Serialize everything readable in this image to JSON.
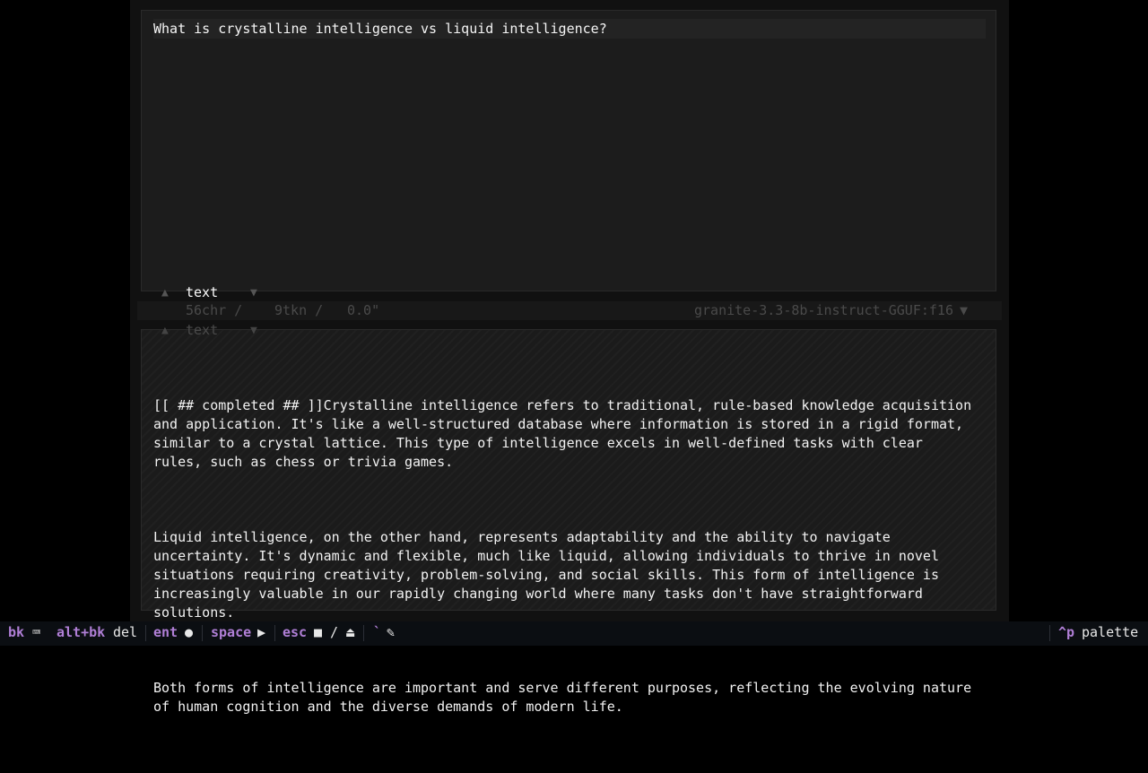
{
  "prompt": {
    "text": "What is crystalline intelligence vs liquid intelligence?"
  },
  "input_type": {
    "label": "text",
    "up": "▲",
    "down": "▼"
  },
  "meta": {
    "chars": "56chr /",
    "tokens": "9tkn /",
    "time": "0.0\"",
    "model": "granite-3.3-8b-instruct-GGUF:f16",
    "model_arrow": "▼"
  },
  "output_type": {
    "label": "text",
    "up": "▲",
    "down": "▼"
  },
  "output": {
    "paragraphs": [
      "[[ ## completed ## ]]Crystalline intelligence refers to traditional, rule-based knowledge acquisition\nand application. It's like a well-structured database where information is stored in a rigid format,\nsimilar to a crystal lattice. This type of intelligence excels in well-defined tasks with clear\nrules, such as chess or trivia games.",
      "Liquid intelligence, on the other hand, represents adaptability and the ability to navigate\nuncertainty. It's dynamic and flexible, much like liquid, allowing individuals to thrive in novel\nsituations requiring creativity, problem-solving, and social skills. This form of intelligence is\nincreasingly valuable in our rapidly changing world where many tasks don't have straightforward\nsolutions.",
      "Both forms of intelligence are important and serve different purposes, reflecting the evolving nature\nof human cognition and the diverse demands of modern life."
    ]
  },
  "statusbar": {
    "bk_key": "bk",
    "bk_icon": "⌨",
    "altbk_key": "alt+bk",
    "altbk_val": "del",
    "ent_key": "ent",
    "ent_icon": "●",
    "space_key": "space",
    "space_icon": "▶",
    "esc_key": "esc",
    "esc_icon": "■ / ⏏",
    "tick_key": "`",
    "tick_icon": "✎",
    "palette_key": "^p",
    "palette_val": "palette"
  },
  "colors": {
    "accent": "#b07fd6",
    "panel_bg": "#1c1c1c",
    "status_bg": "#0b0e12"
  }
}
